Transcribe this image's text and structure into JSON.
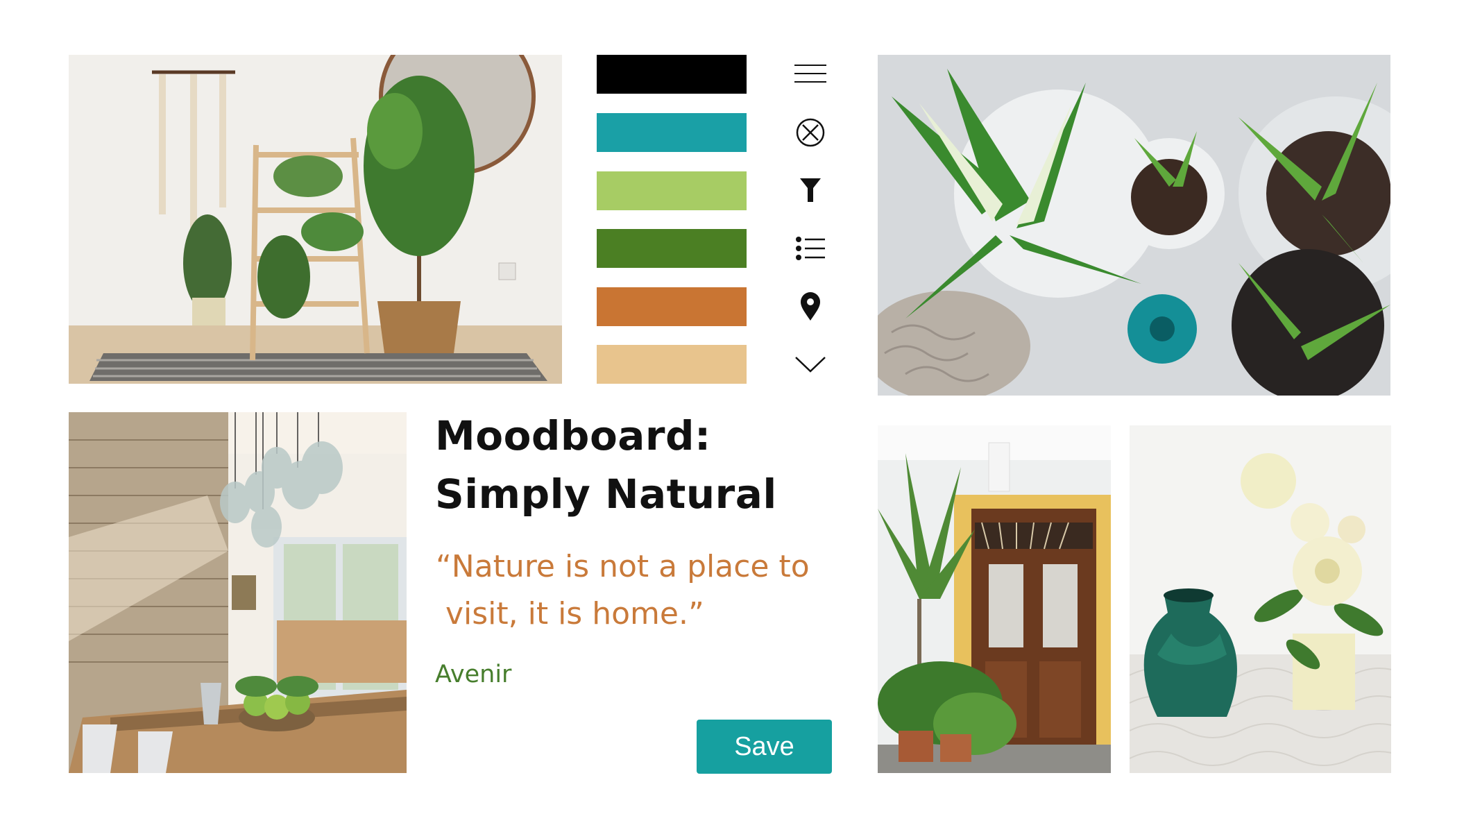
{
  "palette": {
    "swatches": [
      "#000000",
      "#1aa0a6",
      "#a7cc64",
      "#4b7f23",
      "#c97533",
      "#e8c48d"
    ]
  },
  "toolbar": {
    "icons": [
      "menu-icon",
      "close-circle-icon",
      "filter-icon",
      "list-icon",
      "location-pin-icon",
      "chevron-down-icon"
    ]
  },
  "moodboard": {
    "title_line_1": "Moodboard:",
    "title_line_2": "Simply Natural",
    "quote_line_1": "“Nature is not a place to",
    "quote_line_2": " visit, it is home.”",
    "font_name": "Avenir"
  },
  "actions": {
    "save_label": "Save"
  }
}
